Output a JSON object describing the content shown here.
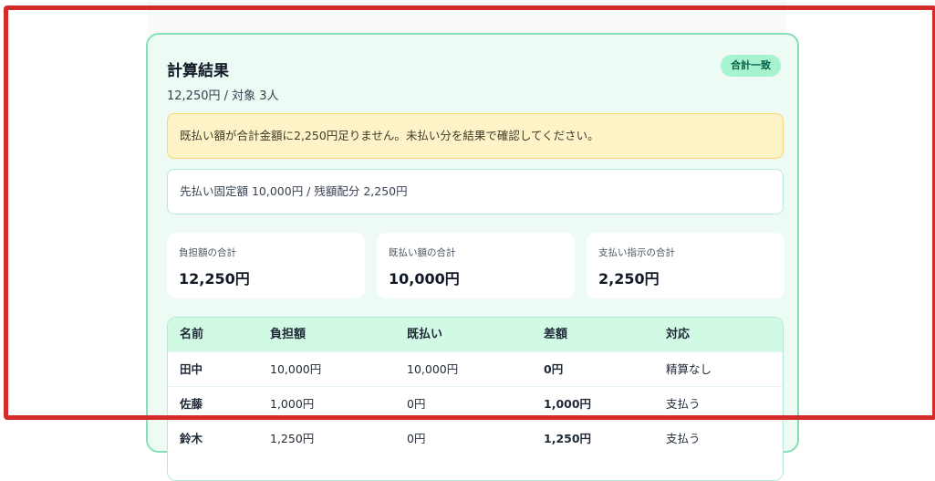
{
  "result": {
    "title": "計算結果",
    "subtitle": "12,250円 / 対象 3人",
    "badge": "合計一致",
    "warning": "既払い額が合計金額に2,250円足りません。未払い分を結果で確認してください。",
    "info": "先払い固定額 10,000円 / 残額配分 2,250円"
  },
  "stats": [
    {
      "label": "負担額の合計",
      "value": "12,250円"
    },
    {
      "label": "既払い額の合計",
      "value": "10,000円"
    },
    {
      "label": "支払い指示の合計",
      "value": "2,250円"
    }
  ],
  "table": {
    "headers": [
      "名前",
      "負担額",
      "既払い",
      "差額",
      "対応"
    ],
    "rows": [
      [
        "田中",
        "10,000円",
        "10,000円",
        "0円",
        "精算なし"
      ],
      [
        "佐藤",
        "1,000円",
        "0円",
        "1,000円",
        "支払う"
      ],
      [
        "鈴木",
        "1,250円",
        "0円",
        "1,250円",
        "支払う"
      ]
    ]
  },
  "colors": {
    "card_bg": "#edfbf4",
    "card_border": "#86e0b5",
    "warning_bg": "#fdf3c7",
    "badge_bg": "#a7f3d0",
    "highlight_frame": "#d42a2a"
  }
}
